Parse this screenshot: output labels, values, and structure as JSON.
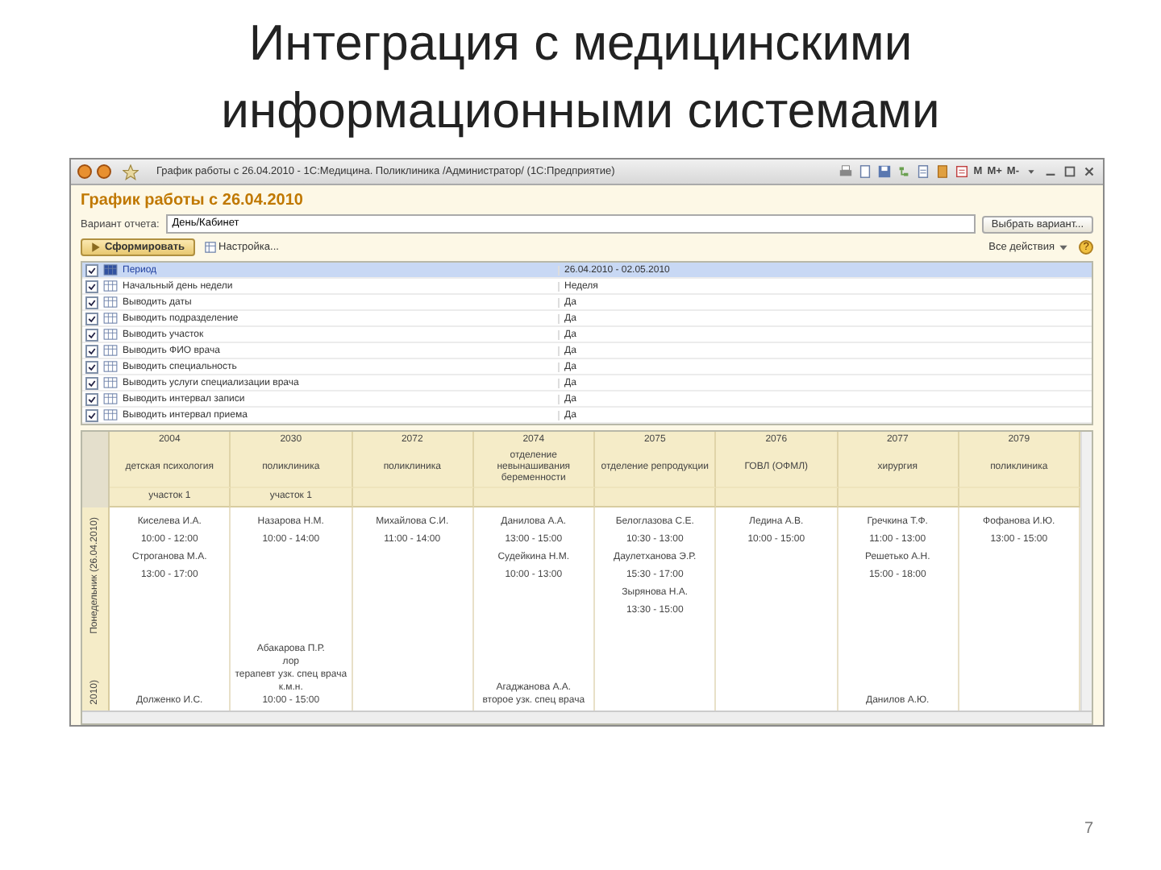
{
  "slide": {
    "title_lines": [
      "Интеграция с медицинскими",
      "информационными системами"
    ],
    "page_number": "7"
  },
  "window": {
    "title": "График работы с 26.04.2010 - 1С:Медицина. Поликлиника /Администратор/ (1С:Предприятие)",
    "memory_buttons": [
      "M",
      "M+",
      "M-"
    ]
  },
  "form": {
    "heading": "График работы с 26.04.2010",
    "variant_label": "Вариант отчета:",
    "variant_value": "День/Кабинет",
    "choose_button": "Выбрать вариант...",
    "generate_button": "Сформировать",
    "settings_button": "Настройка...",
    "all_actions": "Все действия",
    "help": "?"
  },
  "settings": {
    "rows": [
      {
        "checked": true,
        "selected": true,
        "name": "Период",
        "value": "26.04.2010 - 02.05.2010"
      },
      {
        "checked": true,
        "selected": false,
        "name": "Начальный день недели",
        "value": "Неделя"
      },
      {
        "checked": true,
        "selected": false,
        "name": "Выводить даты",
        "value": "Да"
      },
      {
        "checked": true,
        "selected": false,
        "name": "Выводить подразделение",
        "value": "Да"
      },
      {
        "checked": true,
        "selected": false,
        "name": "Выводить участок",
        "value": "Да"
      },
      {
        "checked": true,
        "selected": false,
        "name": "Выводить ФИО врача",
        "value": "Да"
      },
      {
        "checked": true,
        "selected": false,
        "name": "Выводить специальность",
        "value": "Да"
      },
      {
        "checked": true,
        "selected": false,
        "name": "Выводить услуги специализации врача",
        "value": "Да"
      },
      {
        "checked": true,
        "selected": false,
        "name": "Выводить интервал записи",
        "value": "Да"
      },
      {
        "checked": true,
        "selected": false,
        "name": "Выводить интервал приема",
        "value": "Да"
      }
    ]
  },
  "schedule": {
    "columns": [
      {
        "room": "2004",
        "department": "детская психология",
        "area": "участок 1"
      },
      {
        "room": "2030",
        "department": "поликлиника",
        "area": "участок 1"
      },
      {
        "room": "2072",
        "department": "поликлиника"
      },
      {
        "room": "2074",
        "department": "отделение невынашивания беременности"
      },
      {
        "room": "2075",
        "department": "отделение репродукции"
      },
      {
        "room": "2076",
        "department": "ГОВЛ (ОФМЛ)"
      },
      {
        "room": "2077",
        "department": "хирургия"
      },
      {
        "room": "2079",
        "department": "поликлиника"
      }
    ],
    "days": [
      {
        "label": "Понедельник (26.04.2010)",
        "cells": [
          [
            "Киселева И.А.",
            "10:00 - 12:00",
            "Строганова М.А.",
            "13:00 - 17:00"
          ],
          [
            "Назарова Н.М.",
            "10:00 - 14:00"
          ],
          [
            "Михайлова С.И.",
            "11:00 - 14:00"
          ],
          [
            "Данилова А.А.",
            "13:00 - 15:00",
            "Судейкина Н.М.",
            "10:00 - 13:00"
          ],
          [
            "Белоглазова С.Е.",
            "10:30 - 13:00",
            "Даулетханова Э.Р.",
            "15:30 - 17:00",
            "Зырянова Н.А.",
            "13:30 - 15:00"
          ],
          [
            "Ледина А.В.",
            "10:00 - 15:00"
          ],
          [
            "Гречкина Т.Ф.",
            "11:00 - 13:00",
            "Решетько А.Н.",
            "15:00 - 18:00"
          ],
          [
            "Фофанова И.Ю.",
            "13:00 - 15:00"
          ]
        ]
      },
      {
        "label": "2010)",
        "cells": [
          [
            "Долженко И.С."
          ],
          [
            "Абакарова П.Р.",
            "лор",
            "терапевт узк. спец врача",
            "к.м.н.",
            "10:00 - 15:00"
          ],
          [],
          [
            "Агаджанова А.А.",
            "второе узк. спец врача"
          ],
          [],
          [],
          [
            "Данилов А.Ю."
          ],
          []
        ]
      }
    ]
  }
}
